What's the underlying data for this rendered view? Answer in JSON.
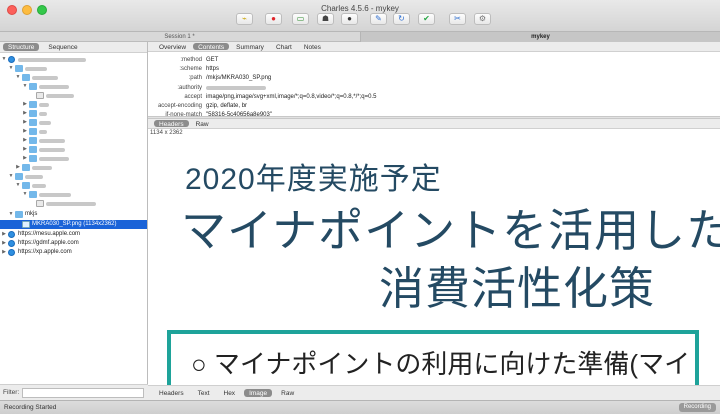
{
  "window": {
    "title": "Charles 4.5.6 - mykey"
  },
  "toolbar": {
    "buttons": [
      {
        "name": "broom-icon",
        "glyph": "⌁",
        "color": "#c9a300"
      },
      {
        "name": "record-icon",
        "glyph": "●",
        "color": "#e0242a"
      },
      {
        "name": "throttle-icon",
        "glyph": "▭",
        "color": "#2e8b2e"
      },
      {
        "name": "turtle-icon",
        "glyph": "☗",
        "color": "#444"
      },
      {
        "name": "stop-icon",
        "glyph": "●",
        "color": "#333"
      },
      {
        "name": "pen-icon",
        "glyph": "✎",
        "color": "#2f6fd0"
      },
      {
        "name": "refresh-icon",
        "glyph": "↻",
        "color": "#2f6fd0"
      },
      {
        "name": "check-icon",
        "glyph": "✔",
        "color": "#28a745"
      },
      {
        "name": "tools-icon",
        "glyph": "✂",
        "color": "#2f6fd0"
      },
      {
        "name": "gear-icon",
        "glyph": "⚙",
        "color": "#777"
      }
    ]
  },
  "sessions": {
    "tab1": "Session 1 *",
    "tab2": "mykey"
  },
  "left_tabs": {
    "structure": "Structure",
    "sequence": "Sequence"
  },
  "tree": {
    "mkjs": "mkjs",
    "selected_file": "MKRA030_SP.png (1134x2362)",
    "host1": "https://mesu.apple.com",
    "host2": "https://gdmf.apple.com",
    "host3": "https://xp.apple.com"
  },
  "filter": {
    "label": "Filter:"
  },
  "right_tabs": [
    "Overview",
    "Contents",
    "Summary",
    "Chart",
    "Notes"
  ],
  "active_right_tab": "Contents",
  "request_headers": [
    {
      "key": ":method",
      "value": "GET"
    },
    {
      "key": ":scheme",
      "value": "https"
    },
    {
      "key": ":path",
      "value": "/mkjs/MKRA030_SP.png"
    },
    {
      "key": ":authority",
      "value": ""
    },
    {
      "key": "accept",
      "value": "image/png,image/svg+xml,image/*;q=0.8,video/*;q=0.8,*/*;q=0.5"
    },
    {
      "key": "accept-encoding",
      "value": "gzip, deflate, br"
    },
    {
      "key": "if-none-match",
      "value": "\"58316-5c40656a8e903\""
    }
  ],
  "response_tabs": {
    "headers": "Headers",
    "raw": "Raw"
  },
  "image_dims": "1134 x 2362",
  "image_text": {
    "line1": "2020年度実施予定",
    "line2": "マイナポイントを活用した",
    "line3": "消費活性化策",
    "bullet": "○ マイナポイントの利用に向けた準備(マイ"
  },
  "bottom_tabs": [
    "Headers",
    "Text",
    "Hex",
    "Image",
    "Raw"
  ],
  "active_bottom_tab": "Image",
  "status": {
    "left": "Recording Started",
    "button": "Recording"
  }
}
